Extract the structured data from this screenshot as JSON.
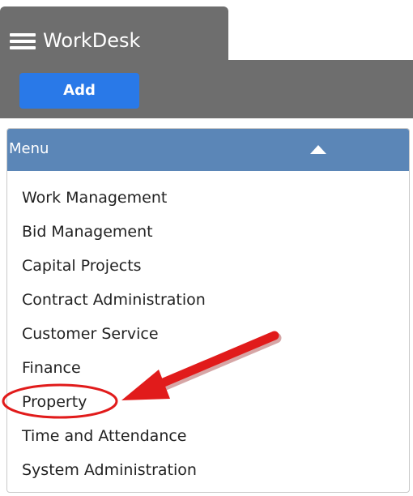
{
  "app": {
    "title": "WorkDesk"
  },
  "toolbar": {
    "add_label": "Add"
  },
  "menu": {
    "header": "Menu",
    "items": [
      {
        "label": "Work Management"
      },
      {
        "label": "Bid Management"
      },
      {
        "label": "Capital Projects"
      },
      {
        "label": "Contract Administration"
      },
      {
        "label": "Customer Service"
      },
      {
        "label": "Finance"
      },
      {
        "label": "Property"
      },
      {
        "label": "Time and Attendance"
      },
      {
        "label": "System Administration"
      }
    ]
  },
  "annotation": {
    "highlighted_item": "Property",
    "color": "#e11b1b"
  },
  "colors": {
    "chrome": "#6e6e6e",
    "accent": "#2979e8",
    "menu_header": "#5b86b7"
  }
}
